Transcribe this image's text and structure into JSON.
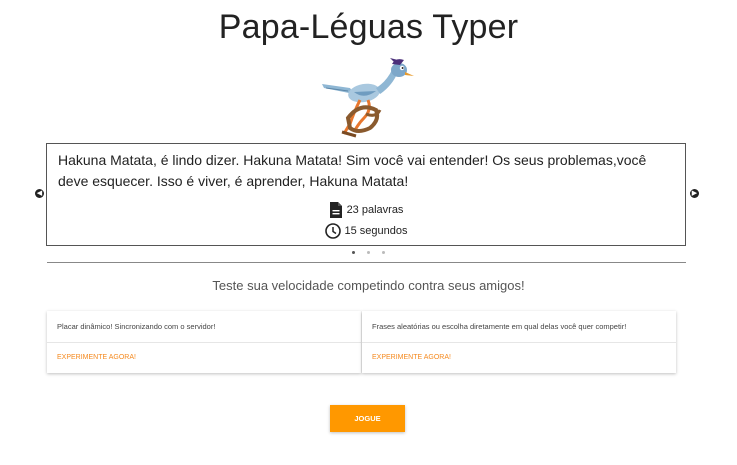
{
  "header": {
    "title": "Papa-Léguas Typer"
  },
  "carousel": {
    "quote": "Hakuna Matata, é lindo dizer. Hakuna Matata! Sim você vai entender! Os seus problemas,você deve esquecer. Isso é viver, é aprender, Hakuna Matata!",
    "words": "23 palavras",
    "time": "15 segundos",
    "slides": 3,
    "active_slide": 1,
    "icons": [
      "document-icon",
      "clock-icon",
      "chevron-left-icon",
      "chevron-right-icon"
    ]
  },
  "tagline": "Teste sua velocidade competindo contra seus amigos!",
  "cards": [
    {
      "text": "Placar dinâmico! Sincronizando com o servidor!",
      "link": "Experimente agora!"
    },
    {
      "text": "Frases aleatórias ou escolha diretamente em qual delas você quer competir!",
      "link": "Experimente agora!"
    }
  ],
  "play_button": "Jogue",
  "colors": {
    "accent": "#ff9800",
    "link": "#f5891e"
  }
}
